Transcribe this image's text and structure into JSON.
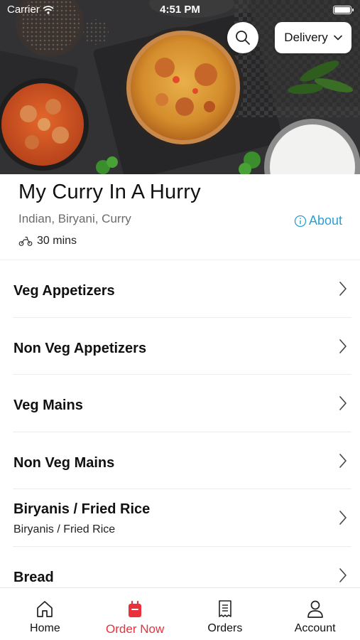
{
  "status_bar": {
    "carrier": "Carrier",
    "time": "4:51 PM"
  },
  "hero": {
    "search_icon": "magnifying-glass",
    "delivery_mode": "Delivery"
  },
  "restaurant": {
    "name": "My Curry In A Hurry",
    "cuisines": "Indian, Biryani, Curry",
    "about_label": "About",
    "delivery_time": "30 mins"
  },
  "menu": {
    "categories": [
      {
        "title": "Veg Appetizers",
        "subtitle": ""
      },
      {
        "title": "Non Veg Appetizers",
        "subtitle": ""
      },
      {
        "title": "Veg Mains",
        "subtitle": ""
      },
      {
        "title": "Non Veg Mains",
        "subtitle": ""
      },
      {
        "title": "Biryanis / Fried Rice",
        "subtitle": "Biryanis / Fried Rice"
      },
      {
        "title": "Bread",
        "subtitle": ""
      }
    ]
  },
  "tabbar": {
    "tabs": [
      {
        "label": "Home",
        "icon": "home-icon",
        "active": false
      },
      {
        "label": "Order Now",
        "icon": "shopping-bag-icon",
        "active": true
      },
      {
        "label": "Orders",
        "icon": "receipt-icon",
        "active": false
      },
      {
        "label": "Account",
        "icon": "person-icon",
        "active": false
      }
    ]
  },
  "colors": {
    "accent": "#e8313b",
    "link": "#2a9fd0",
    "hero_background": "#2f2f31"
  }
}
